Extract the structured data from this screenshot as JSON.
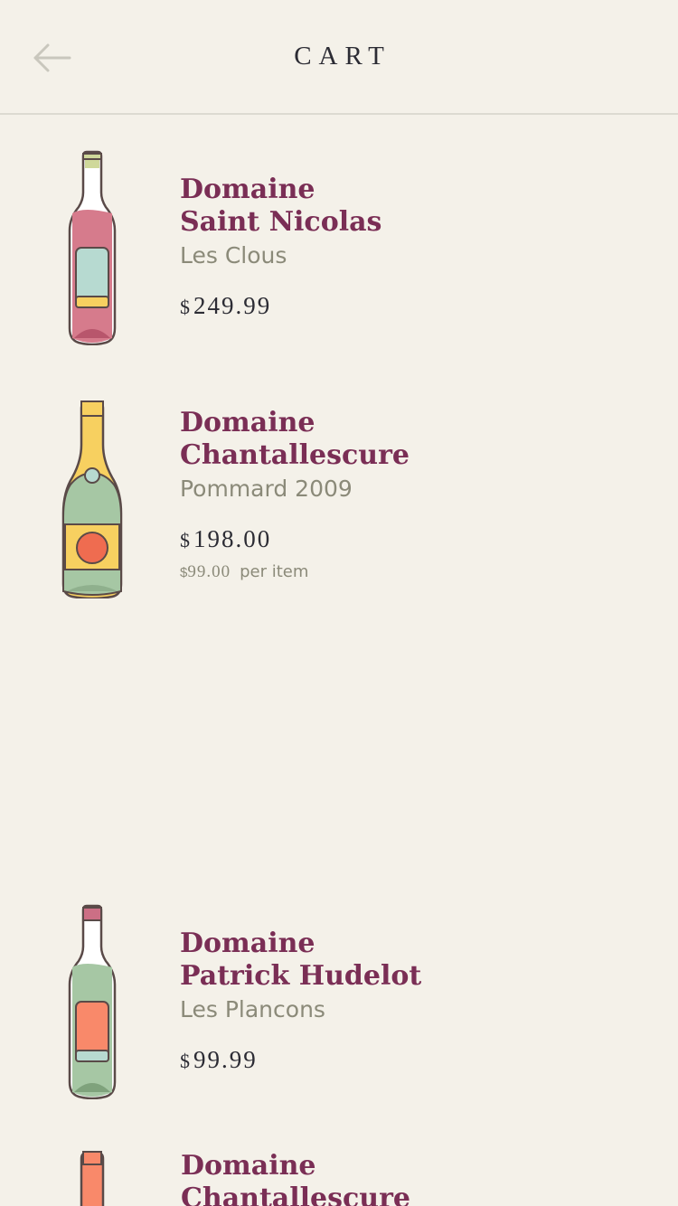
{
  "header": {
    "title": "CART",
    "back_icon": "arrow-left-icon"
  },
  "items": [
    {
      "name_line1": "Domaine",
      "name_line2": "Saint Nicolas",
      "subtitle": "Les Clous",
      "currency": "$",
      "price": "249.99",
      "bottle_icon": "rose-wine-bottle-icon",
      "colors": {
        "body": "#d67b8c",
        "cap": "#cfd89a",
        "label": "#b7dad1",
        "band": "#f7d060"
      }
    },
    {
      "name_line1": "Domaine",
      "name_line2": "Chantallescure",
      "subtitle": "Pommard 2009",
      "currency": "$",
      "price": "198.00",
      "unit_currency": "$",
      "unit_price": "99.00",
      "unit_label": "per item",
      "bottle_icon": "champagne-bottle-icon",
      "colors": {
        "body": "#a6c7a4",
        "cap": "#f7d060",
        "label": "#f7d060",
        "seal": "#ef6c50"
      }
    },
    {
      "name_line1": "Domaine",
      "name_line2": "Patrick Hudelot",
      "subtitle": "Les Plancons",
      "currency": "$",
      "price": "99.99",
      "bottle_icon": "green-wine-bottle-icon",
      "colors": {
        "body": "#a6c7a4",
        "cap": "#cc6f85",
        "label": "#f9896a",
        "band": "#b7dad1"
      }
    },
    {
      "name_line1": "Domaine",
      "name_line2": "Chantallescure",
      "bottle_icon": "orange-wine-bottle-icon",
      "colors": {
        "cap": "#f9896a"
      }
    }
  ],
  "colors": {
    "background": "#f4f1e9",
    "accent": "#7a2e55",
    "text_dark": "#2c2c34",
    "text_muted": "#8b8a79"
  }
}
